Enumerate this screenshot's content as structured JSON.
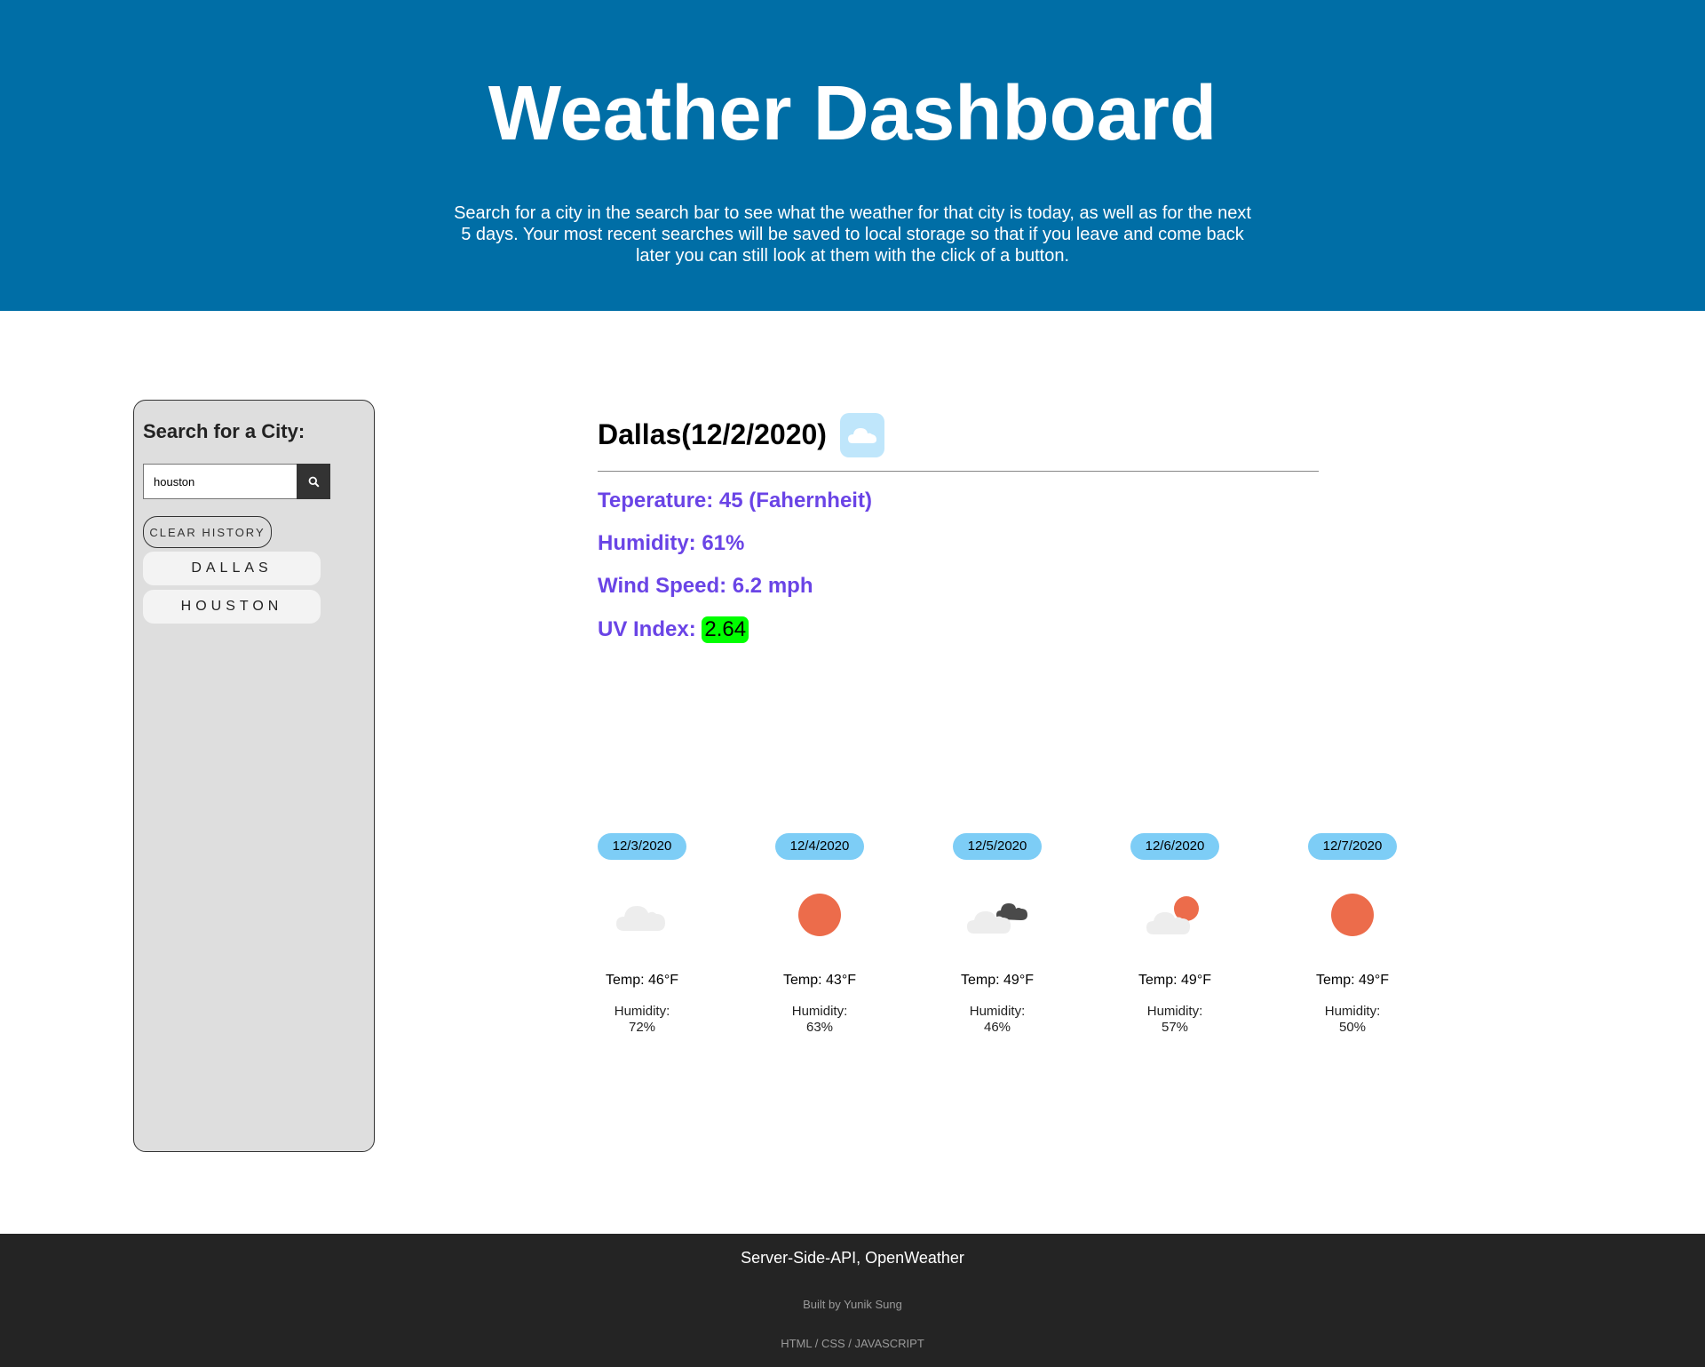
{
  "header": {
    "title": "Weather Dashboard",
    "description": "Search for a city in the search bar to see what the weather for that city is today, as well as for the next 5 days. Your most recent searches will be saved to local storage so that if you leave and come back later you can still look at them with the click of a button."
  },
  "sidebar": {
    "heading": "Search for a City:",
    "search_value": "houston",
    "search_icon": "search-icon",
    "clear_label": "CLEAR HISTORY",
    "history": [
      "DALLAS",
      "HOUSTON"
    ]
  },
  "today": {
    "title": "Dallas(12/2/2020)",
    "icon": "cloud-icon",
    "temperature": "Teperature: 45 (Fahernheit)",
    "humidity": "Humidity: 61%",
    "wind": "Wind Speed: 6.2 mph",
    "uv_label": "UV Index:",
    "uv_value": "2.64",
    "uv_color": "#00ff00"
  },
  "forecast": [
    {
      "date": "12/3/2020",
      "icon": "cloud-icon",
      "temp": "Temp: 46°F",
      "humidity_label": "Humidity:",
      "humidity": "72%"
    },
    {
      "date": "12/4/2020",
      "icon": "sun-icon",
      "temp": "Temp: 43°F",
      "humidity_label": "Humidity:",
      "humidity": "63%"
    },
    {
      "date": "12/5/2020",
      "icon": "broken-clouds-icon",
      "temp": "Temp: 49°F",
      "humidity_label": "Humidity:",
      "humidity": "46%"
    },
    {
      "date": "12/6/2020",
      "icon": "partly-sunny-icon",
      "temp": "Temp: 49°F",
      "humidity_label": "Humidity:",
      "humidity": "57%"
    },
    {
      "date": "12/7/2020",
      "icon": "sun-icon",
      "temp": "Temp: 49°F",
      "humidity_label": "Humidity:",
      "humidity": "50%"
    }
  ],
  "footer": {
    "line1": "Server-Side-API, OpenWeather",
    "line2": "Built by Yunik Sung",
    "line3": "HTML / CSS / JAVASCRIPT"
  },
  "colors": {
    "header_bg": "#006ea6",
    "stat_text": "#6a44e6",
    "date_pill": "#7dcdf6",
    "sun": "#ec6c4b",
    "footer_bg": "#242424"
  }
}
